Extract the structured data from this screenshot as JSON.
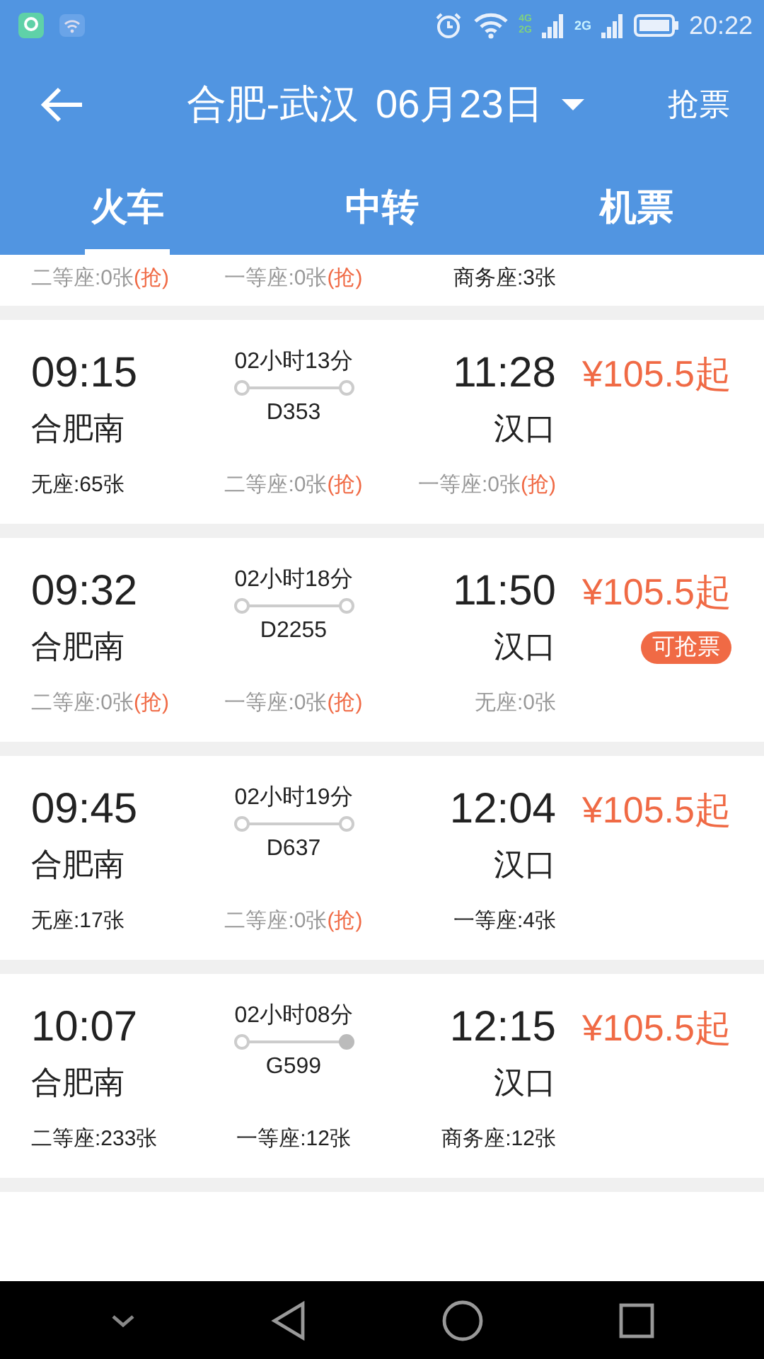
{
  "status_bar": {
    "time": "20:22",
    "sim1_labels": [
      "4G",
      "2G"
    ],
    "sim2_label": "2G"
  },
  "header": {
    "route": "合肥-武汉",
    "date": "06月23日",
    "action": "抢票"
  },
  "tabs": [
    {
      "label": "火车",
      "selected": true
    },
    {
      "label": "中转",
      "selected": false
    },
    {
      "label": "机票",
      "selected": false
    }
  ],
  "trains": [
    {
      "seats": [
        {
          "label": "二等座:0张",
          "grab": "(抢)",
          "available": false
        },
        {
          "label": "一等座:0张",
          "grab": "(抢)",
          "available": false
        },
        {
          "label": "商务座:3张",
          "available": true
        }
      ]
    },
    {
      "depart": "09:15",
      "from": "合肥南",
      "duration": "02小时13分",
      "number": "D353",
      "end_filled": false,
      "arrive": "11:28",
      "to": "汉口",
      "price": "¥105.5起",
      "seats": [
        {
          "label": "无座:65张",
          "available": true
        },
        {
          "label": "二等座:0张",
          "grab": "(抢)",
          "available": false
        },
        {
          "label": "一等座:0张",
          "grab": "(抢)",
          "available": false
        }
      ]
    },
    {
      "depart": "09:32",
      "from": "合肥南",
      "duration": "02小时18分",
      "number": "D2255",
      "end_filled": false,
      "arrive": "11:50",
      "to": "汉口",
      "price": "¥105.5起",
      "badge": "可抢票",
      "seats": [
        {
          "label": "二等座:0张",
          "grab": "(抢)",
          "available": false
        },
        {
          "label": "一等座:0张",
          "grab": "(抢)",
          "available": false
        },
        {
          "label": "无座:0张",
          "available": false
        }
      ]
    },
    {
      "depart": "09:45",
      "from": "合肥南",
      "duration": "02小时19分",
      "number": "D637",
      "end_filled": false,
      "arrive": "12:04",
      "to": "汉口",
      "price": "¥105.5起",
      "seats": [
        {
          "label": "无座:17张",
          "available": true
        },
        {
          "label": "二等座:0张",
          "grab": "(抢)",
          "available": false
        },
        {
          "label": "一等座:4张",
          "available": true
        }
      ]
    },
    {
      "depart": "10:07",
      "from": "合肥南",
      "duration": "02小时08分",
      "number": "G599",
      "end_filled": true,
      "arrive": "12:15",
      "to": "汉口",
      "price": "¥105.5起",
      "seats": [
        {
          "label": "二等座:233张",
          "available": true
        },
        {
          "label": "一等座:12张",
          "available": true
        },
        {
          "label": "商务座:12张",
          "available": true
        }
      ]
    }
  ]
}
